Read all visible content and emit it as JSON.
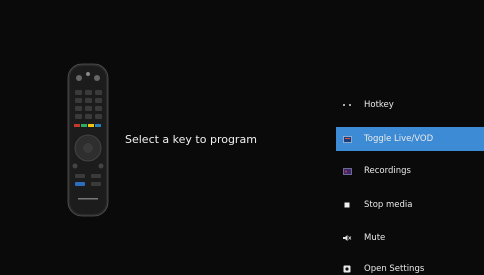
{
  "prompt": {
    "text": "Select a key to program"
  },
  "menu": {
    "items": [
      {
        "label": "Hotkey",
        "icon": "dots-icon",
        "selected": false
      },
      {
        "label": "Toggle Live/VOD",
        "icon": "live-vod-icon",
        "selected": true
      },
      {
        "label": "Recordings",
        "icon": "recordings-icon",
        "selected": false
      },
      {
        "label": "Stop media",
        "icon": "stop-icon",
        "selected": false
      },
      {
        "label": "Mute",
        "icon": "mute-icon",
        "selected": false
      },
      {
        "label": "Open Settings",
        "icon": "settings-icon",
        "selected": false
      }
    ]
  },
  "colors": {
    "background": "#0a0a0a",
    "selection": "#3d8bd4",
    "text": "#eaeaea"
  }
}
